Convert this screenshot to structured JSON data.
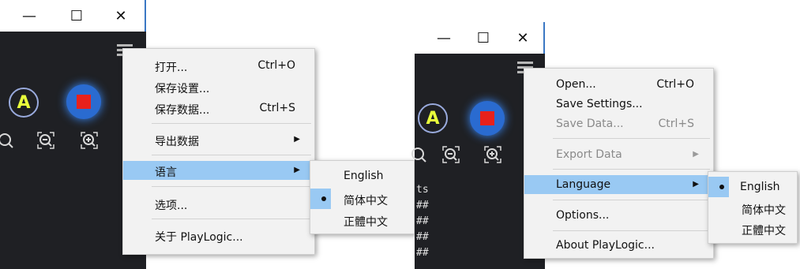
{
  "left": {
    "menu": {
      "items": [
        {
          "label": "打开...",
          "shortcut": "Ctrl+O"
        },
        {
          "label": "保存设置...",
          "shortcut": ""
        },
        {
          "label": "保存数据...",
          "shortcut": "Ctrl+S"
        },
        {
          "label": "导出数据",
          "shortcut": ""
        },
        {
          "label": "语言",
          "shortcut": ""
        },
        {
          "label": "选项...",
          "shortcut": ""
        },
        {
          "label": "关于 PlayLogic...",
          "shortcut": ""
        }
      ]
    },
    "submenu": {
      "items": [
        "English",
        "简体中文",
        "正體中文"
      ]
    }
  },
  "right": {
    "menu": {
      "items": [
        {
          "label": "Open...",
          "shortcut": "Ctrl+O"
        },
        {
          "label": "Save Settings...",
          "shortcut": ""
        },
        {
          "label": "Save Data...",
          "shortcut": "Ctrl+S"
        },
        {
          "label": "Export Data",
          "shortcut": ""
        },
        {
          "label": "Language",
          "shortcut": ""
        },
        {
          "label": "Options...",
          "shortcut": ""
        },
        {
          "label": "About PlayLogic...",
          "shortcut": ""
        }
      ]
    },
    "submenu": {
      "items": [
        "English",
        "简体中文",
        "正體中文"
      ]
    },
    "background_text": [
      "ts",
      "##",
      "##",
      "##",
      "##"
    ]
  },
  "window": {
    "minimize": "—",
    "maximize": "☐",
    "close": "✕"
  },
  "colors": {
    "selection": "#99c9f3",
    "app_bg": "#1f2024",
    "a_letter": "#e9ff3b",
    "record_red": "#e8211b"
  }
}
